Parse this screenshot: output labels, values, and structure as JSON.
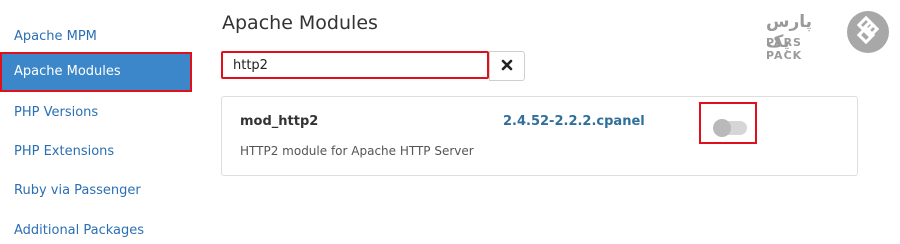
{
  "sidebar": {
    "items": [
      {
        "label": "Apache MPM",
        "active": false
      },
      {
        "label": "Apache Modules",
        "active": true
      },
      {
        "label": "PHP Versions",
        "active": false
      },
      {
        "label": "PHP Extensions",
        "active": false
      },
      {
        "label": "Ruby via Passenger",
        "active": false
      },
      {
        "label": "Additional Packages",
        "active": false
      }
    ]
  },
  "main": {
    "title": "Apache Modules",
    "search": {
      "value": "http2",
      "placeholder": ""
    },
    "clear_icon": "close-icon",
    "module": {
      "name": "mod_http2",
      "version": "2.4.52-2.2.2.cpanel",
      "description": "HTTP2 module for Apache HTTP Server",
      "enabled": false
    }
  },
  "logo": {
    "text_fa": "پارس پک",
    "text_en": "PARS PACK"
  },
  "colors": {
    "accent": "#3b87c9",
    "link": "#2a6fb5",
    "highlight": "#e0101a",
    "version": "#2f6f9a"
  }
}
